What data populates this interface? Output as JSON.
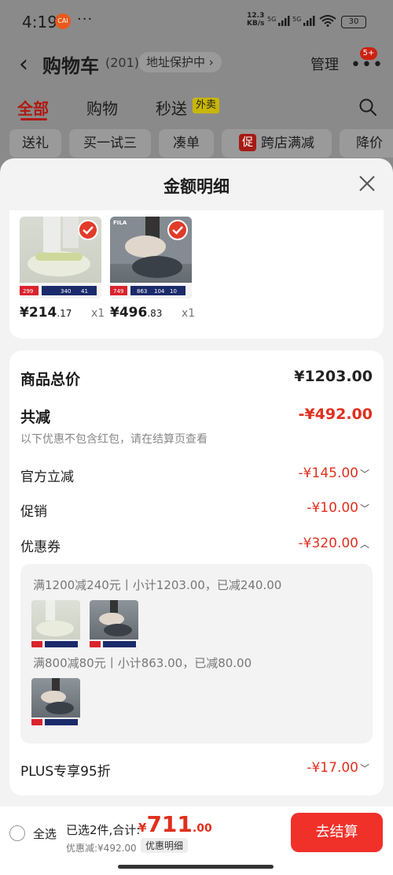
{
  "status": {
    "time": "4:19",
    "app_badge": "CAI",
    "more": "···",
    "net_speed_value": "12.3",
    "net_speed_unit": "KB/s",
    "sig1": "5G",
    "sig2": "5G",
    "battery": "30"
  },
  "header": {
    "back": "‹",
    "title": "购物车",
    "count": "(201)",
    "address_chip": "地址保护中 ›",
    "manage": "管理",
    "more_badge": "5+"
  },
  "tabs": {
    "all": "全部",
    "buy": "购物",
    "instant": "秒送",
    "instant_badge": "外卖"
  },
  "chips": {
    "gift": "送礼",
    "trial": "买一试三",
    "bundle": "凑单",
    "promo_badge": "促",
    "cross_store": "跨店满减",
    "price_drop": "降价"
  },
  "sheet": {
    "title": "金额明细",
    "items": [
      {
        "price_int": "¥214",
        "price_dec": ".17",
        "qty": "x1"
      },
      {
        "price_int": "¥496",
        "price_dec": ".83",
        "qty": "x1"
      }
    ],
    "summary": {
      "total_label": "商品总价",
      "total_value": "¥1203.00",
      "reduce_label": "共减",
      "reduce_value": "-¥492.00",
      "reduce_note": "以下优惠不包含红包，请在结算页查看",
      "official_label": "官方立减",
      "official_value": "-¥145.00",
      "promo_label": "促销",
      "promo_value": "-¥10.00",
      "coupon_label": "优惠券",
      "coupon_value": "-¥320.00",
      "coupon_line1": "满1200减240元丨小计1203.00，已减240.00",
      "coupon_line2": "满800减80元丨小计863.00，已减80.00",
      "plus_label": "PLUS专享95折",
      "plus_value": "-¥17.00"
    }
  },
  "bottom": {
    "select_all": "全选",
    "selected_text": "已选2件,合计:",
    "total_yen": "¥",
    "total_int": "711",
    "total_dec": ".00",
    "discount_text": "优惠减:¥492.00",
    "detail_chip": "优惠明细",
    "checkout": "去结算"
  },
  "thumbs": {
    "brand": "FILA",
    "p1_nums": [
      "299",
      "340",
      "41"
    ],
    "p2_nums": [
      "749",
      "863",
      "104",
      "10"
    ]
  },
  "colors": {
    "accent_red": "#e0301e",
    "checkout_red": "#f0312a",
    "tab_red": "#b01a12"
  }
}
